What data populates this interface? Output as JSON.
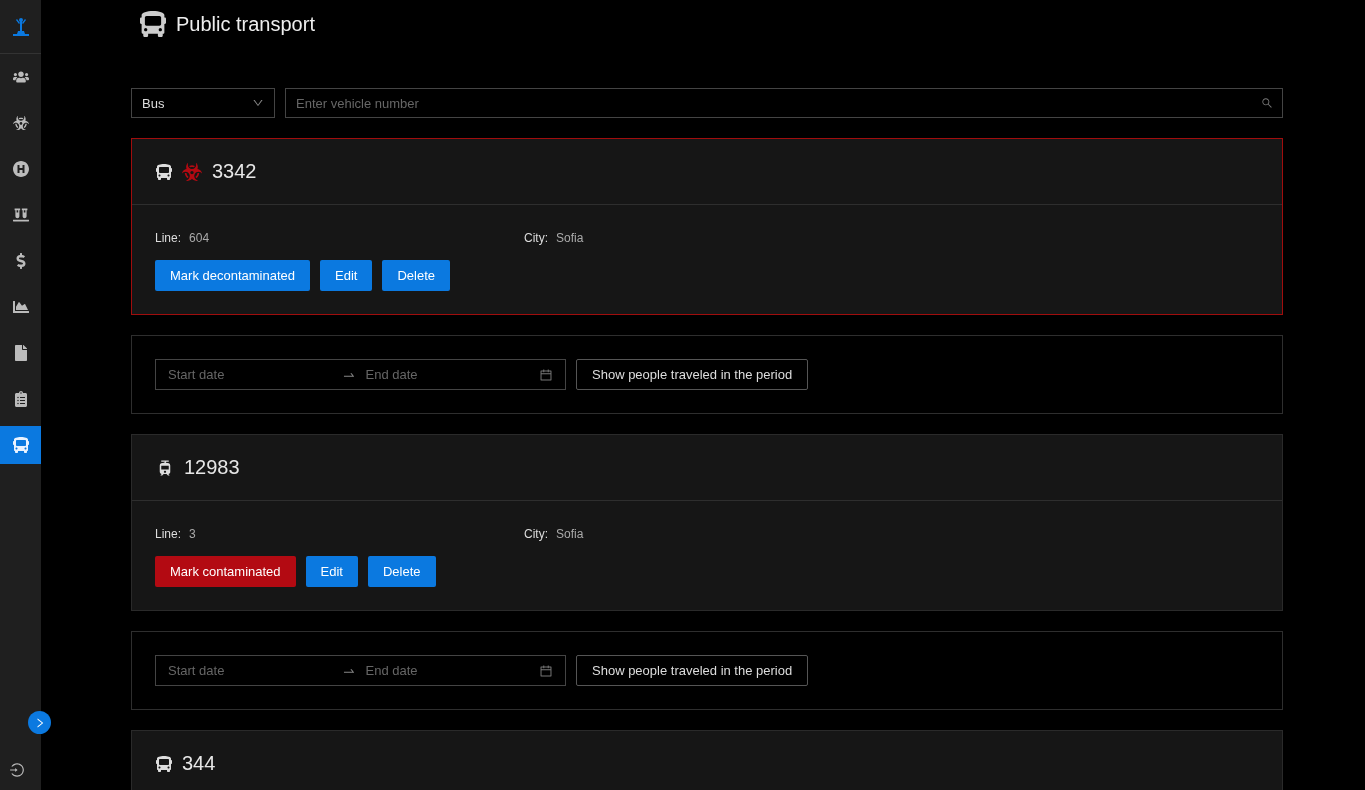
{
  "sidebar": {
    "items": [
      {
        "kind": "people",
        "selected": false
      },
      {
        "kind": "biohazard",
        "selected": false
      },
      {
        "kind": "hospital",
        "selected": false
      },
      {
        "kind": "vials",
        "selected": false
      },
      {
        "kind": "money",
        "selected": false
      },
      {
        "kind": "chart",
        "selected": false
      },
      {
        "kind": "file",
        "selected": false
      },
      {
        "kind": "clipboard",
        "selected": false
      },
      {
        "kind": "bus",
        "selected": true
      }
    ],
    "collapsed": true
  },
  "header": {
    "title": "Public transport"
  },
  "filter": {
    "vehicle_type": "Bus",
    "search": {
      "placeholder": "Enter vehicle number"
    }
  },
  "vehicles": [
    {
      "kind": "bus",
      "number": "3342",
      "contaminated": true,
      "fields": [
        {
          "label": "Line:",
          "value": "604"
        },
        {
          "label": "City:",
          "value": "Sofia"
        }
      ],
      "toggle": "Mark decontaminated",
      "edit": "Edit",
      "delete": "Delete",
      "period": {
        "start": "Start date",
        "end": "End date",
        "button": "Show people traveled in the period"
      }
    },
    {
      "kind": "tram",
      "number": "12983",
      "contaminated": false,
      "fields": [
        {
          "label": "Line:",
          "value": "3"
        },
        {
          "label": "City:",
          "value": "Sofia"
        }
      ],
      "toggle": "Mark contaminated",
      "edit": "Edit",
      "delete": "Delete",
      "period": {
        "start": "Start date",
        "end": "End date",
        "button": "Show people traveled in the period"
      }
    },
    {
      "kind": "bus",
      "number": "344",
      "contaminated": false
    }
  ]
}
